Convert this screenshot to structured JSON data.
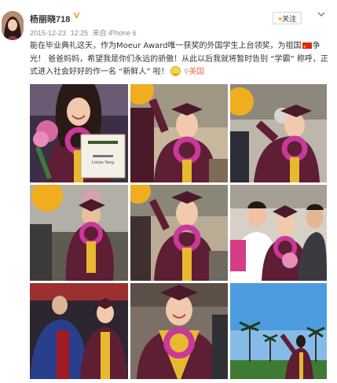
{
  "user": {
    "name": "杨丽晓718",
    "verified_badge": "V",
    "avatar_icon": "avatar"
  },
  "meta": {
    "date": "2015-12-23",
    "time": "12:25",
    "source": "来自 iPhone 6"
  },
  "actions": {
    "follow_plus": "+",
    "follow_label": "关注",
    "menu_icon": "chevron-down-icon"
  },
  "post": {
    "text_part1": "能在毕业典礼这天，作为Moeur Award唯一获奖的外国学生上台领奖，为祖国",
    "text_part2": "争光！ 爸爸妈妈，希望我是你们永远的骄傲！从此以后我就将暂时告别 “学霸” 称呼，正式进入社会好好的作一名 “新鲜人” 啦！",
    "flag_icon": "china-flag-icon",
    "emoji_icon": "smile-emoji-icon",
    "location_icon": "location-pin-icon",
    "location": "美国"
  },
  "photos": {
    "certificate_name": "Lixiao Yang"
  },
  "colors": {
    "gown": "#5e1e34",
    "stole": "#e8b930",
    "lei": "#c9389a",
    "link": "#eb7350",
    "vip": "#f1a531"
  }
}
